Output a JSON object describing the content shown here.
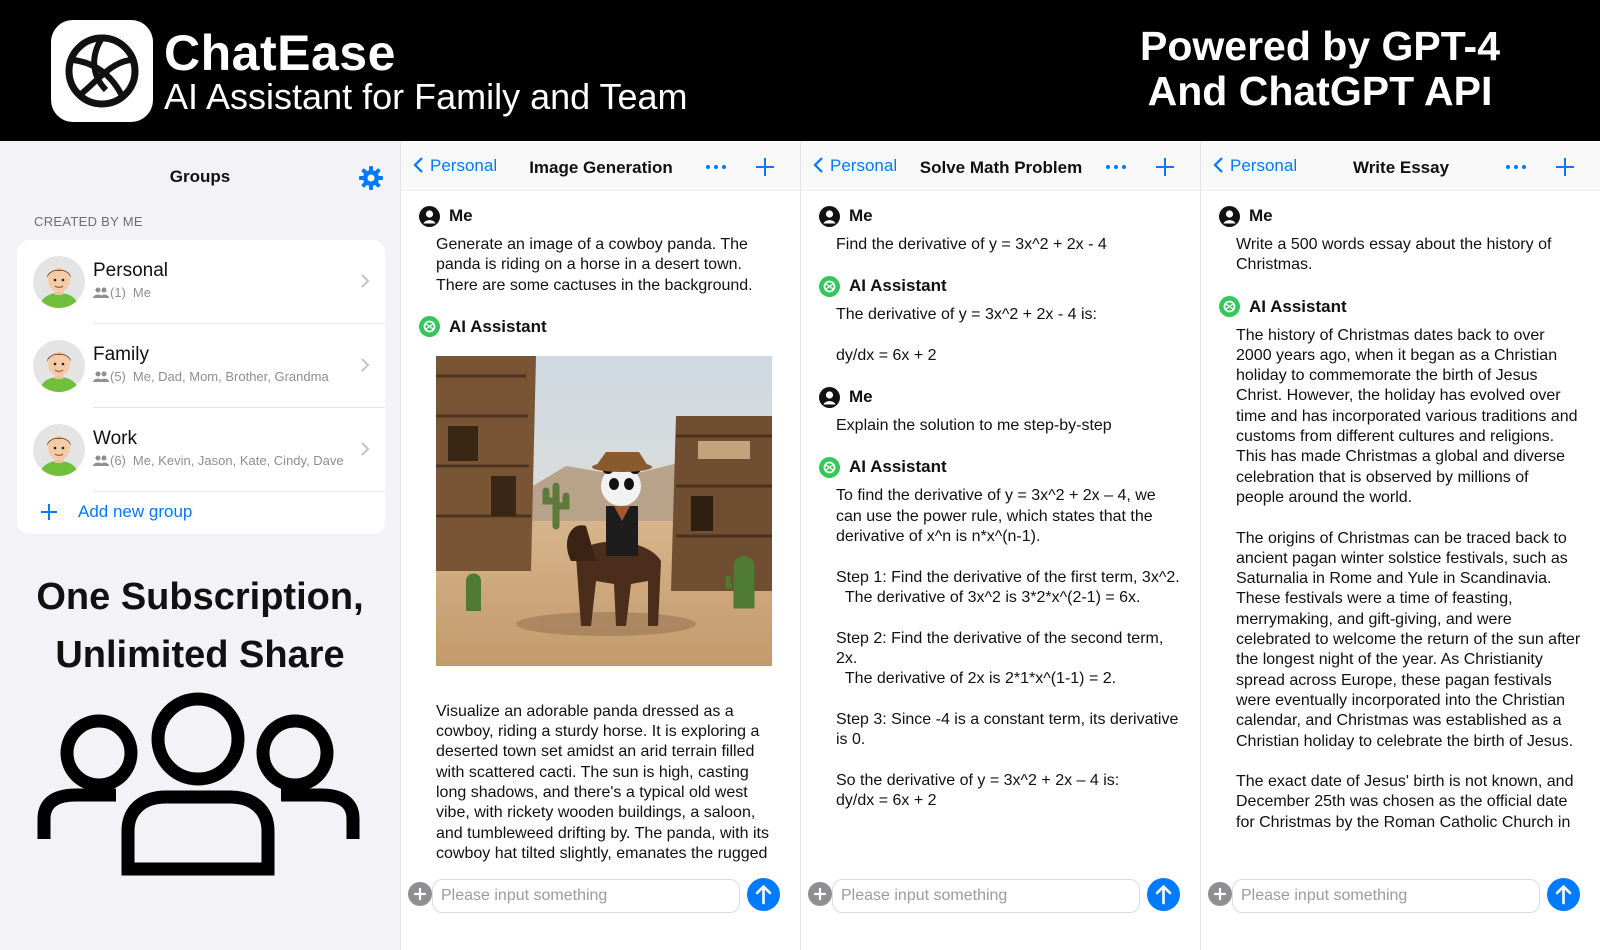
{
  "banner": {
    "app_name": "ChatEase",
    "tagline": "AI Assistant for Family and Team",
    "powered_line1": "Powered by GPT-4",
    "powered_line2": "And ChatGPT API",
    "background": "#000000"
  },
  "groups": {
    "title": "Groups",
    "section_label": "CREATED BY ME",
    "items": [
      {
        "name": "Personal",
        "count": "(1)",
        "members": "Me"
      },
      {
        "name": "Family",
        "count": "(5)",
        "members": "Me, Dad, Mom, Brother, Grandma"
      },
      {
        "name": "Work",
        "count": "(6)",
        "members": "Me, Kevin, Jason, Kate, Cindy, Dave"
      }
    ],
    "add_label": "Add new group",
    "accent": "#007aff"
  },
  "promo": {
    "line1": "One Subscription,",
    "line2": "Unlimited Share"
  },
  "chats": [
    {
      "back_label": "Personal",
      "title": "Image Generation",
      "messages": [
        {
          "who": "Me",
          "text": "Generate an image of a cowboy panda. The panda is riding on a horse in a desert town. There are some cactuses in the background."
        },
        {
          "who": "AI Assistant",
          "text": "Visualize an adorable panda dressed as a cowboy, riding a sturdy horse. It is exploring a deserted town set amidst an arid terrain filled with scattered cacti. The sun is high, casting long shadows, and there's a typical old west vibe, with rickety wooden buildings, a saloon, and tumbleweed drifting by. The panda, with its cowboy hat tilted slightly, emanates the rugged"
        }
      ],
      "placeholder": "Please input something"
    },
    {
      "back_label": "Personal",
      "title": "Solve Math Problem",
      "messages": [
        {
          "who": "Me",
          "text": "Find the derivative of y = 3x^2 + 2x - 4"
        },
        {
          "who": "AI Assistant",
          "text": "The derivative of y = 3x^2 + 2x - 4 is:\n\ndy/dx = 6x + 2"
        },
        {
          "who": "Me",
          "text": "Explain the solution to me step-by-step"
        },
        {
          "who": "AI Assistant",
          "text": "To find the derivative of y = 3x^2 + 2x – 4, we can use the power rule, which states that the derivative of x^n is n*x^(n-1).\n\nStep 1: Find the derivative of the first term, 3x^2.\n  The derivative of 3x^2 is 3*2*x^(2-1) = 6x.\n\nStep 2: Find the derivative of the second term, 2x.\n  The derivative of 2x is 2*1*x^(1-1) = 2.\n\nStep 3: Since -4 is a constant term, its derivative is 0.\n\nSo the derivative of y = 3x^2 + 2x – 4 is:\ndy/dx = 6x + 2"
        }
      ],
      "placeholder": "Please input something"
    },
    {
      "back_label": "Personal",
      "title": "Write Essay",
      "messages": [
        {
          "who": "Me",
          "text": "Write a 500 words essay about the history of Christmas."
        },
        {
          "who": "AI Assistant",
          "text": "The history of Christmas dates back to over 2000 years ago, when it began as a Christian holiday to commemorate the birth of Jesus Christ. However, the holiday has evolved over time and has incorporated various traditions and customs from different cultures and religions. This has made Christmas a global and diverse celebration that is observed by millions of people around the world.\n\nThe origins of Christmas can be traced back to ancient pagan winter solstice festivals, such as Saturnalia in Rome and Yule in Scandinavia. These festivals were a time of feasting, merrymaking, and gift-giving, and were celebrated to welcome the return of the sun after the longest night of the year. As Christianity spread across Europe, these pagan festivals were eventually incorporated into the Christian calendar, and Christmas was established as a Christian holiday to celebrate the birth of Jesus.\n\nThe exact date of Jesus' birth is not known, and December 25th was chosen as the official date for Christmas by the Roman Catholic Church in"
        }
      ],
      "placeholder": "Please input something"
    }
  ],
  "colors": {
    "accent": "#007aff",
    "ai_green": "#34c759",
    "panel_bg": "#f2f2f7"
  },
  "icons": [
    "volleyball-logo-icon",
    "gear-icon",
    "chevron-right-icon",
    "people-icon",
    "plus-icon",
    "chevron-left-icon",
    "more-icon",
    "person-icon",
    "openai-icon",
    "add-circle-icon",
    "send-icon"
  ]
}
